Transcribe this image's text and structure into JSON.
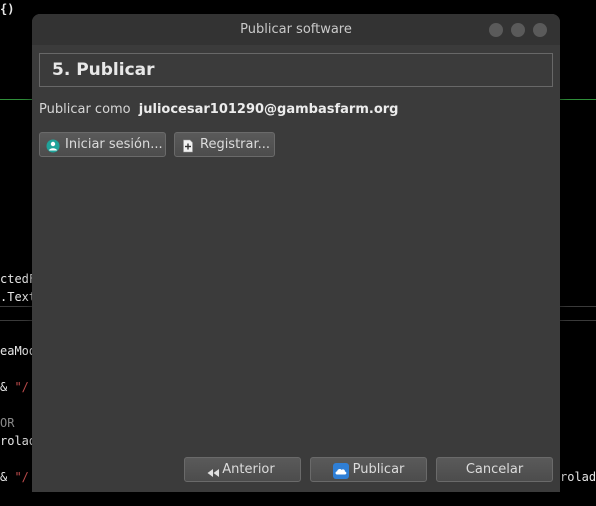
{
  "editor": {
    "lines": [
      {
        "text": "{)",
        "bold": true
      },
      {
        "text": "ctedF"
      },
      {
        "text": ".Text"
      },
      {
        "text": "eaMod"
      },
      {
        "prefix": "& ",
        "str": "\"/"
      },
      {
        "text": "OR",
        "dim": true
      },
      {
        "text": "rolad"
      },
      {
        "prefix": "& ",
        "str": "\"/"
      },
      {
        "text": "rolad"
      }
    ]
  },
  "dialog": {
    "title": "Publicar software",
    "step_title": "5. Publicar",
    "publish_as_label": "Publicar como",
    "account": "juliocesar101290@gambasfarm.org",
    "login_button": "Iniciar sesión...",
    "register_button": "Registrar...",
    "footer": {
      "back_button": "Anterior",
      "publish_button": "Publicar",
      "cancel_button": "Cancelar"
    },
    "icons": {
      "login": "user-login-icon",
      "register": "new-document-icon",
      "back": "rewind-icon",
      "publish": "cloud-icon"
    }
  },
  "colors": {
    "dialog_bg": "#3b3b3b",
    "titlebar_bg": "#333333",
    "accent_green": "#2f8f3a",
    "string_red": "#c85050",
    "publish_icon_blue": "#2f7fd6"
  }
}
